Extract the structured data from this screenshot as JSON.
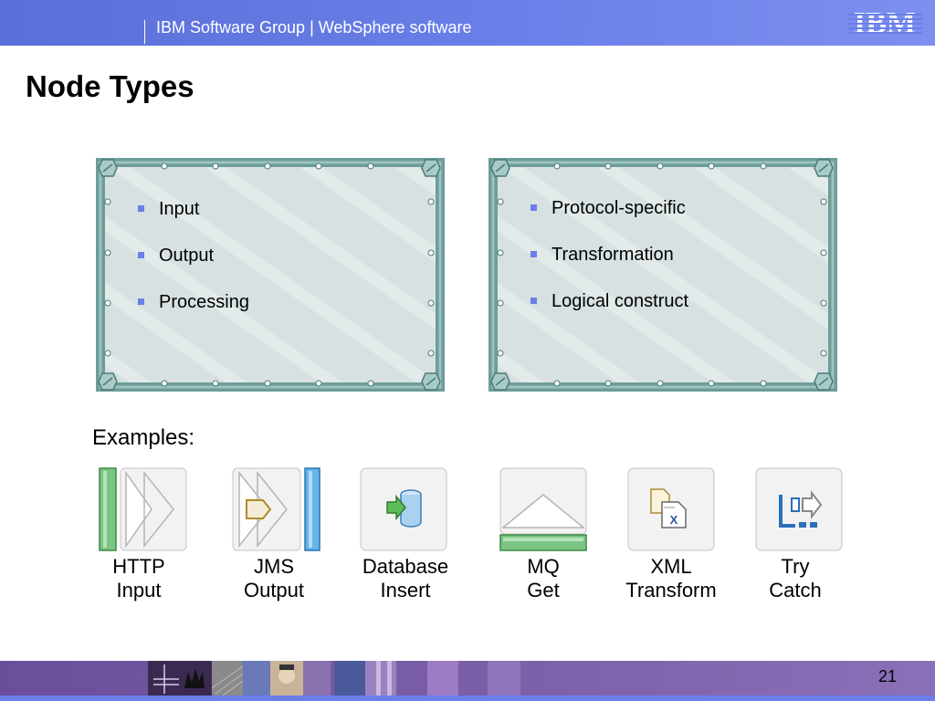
{
  "header": {
    "title": "IBM Software Group | WebSphere software",
    "logo_text": "IBM",
    "background": "#6a7fe8"
  },
  "page": {
    "title": "Node Types",
    "number": "21"
  },
  "panels": [
    {
      "items": [
        "Input",
        "Output",
        "Processing"
      ]
    },
    {
      "items": [
        "Protocol-specific",
        "Transformation",
        "Logical construct"
      ]
    }
  ],
  "examples": {
    "label": "Examples:",
    "nodes": [
      {
        "line1": "HTTP",
        "line2": "Input",
        "icon": "http-input-icon"
      },
      {
        "line1": "JMS",
        "line2": "Output",
        "icon": "jms-output-icon"
      },
      {
        "line1": "Database",
        "line2": "Insert",
        "icon": "database-insert-icon"
      },
      {
        "line1": "MQ",
        "line2": "Get",
        "icon": "mq-get-icon"
      },
      {
        "line1": "XML",
        "line2": "Transform",
        "icon": "xml-transform-icon"
      },
      {
        "line1": "Try",
        "line2": "Catch",
        "icon": "try-catch-icon"
      }
    ]
  },
  "colors": {
    "bullet": "#6a7fe8",
    "frame": "#7aa8a4",
    "panel_fill": "#d9e3e3",
    "footer": "#7a5ea8"
  }
}
